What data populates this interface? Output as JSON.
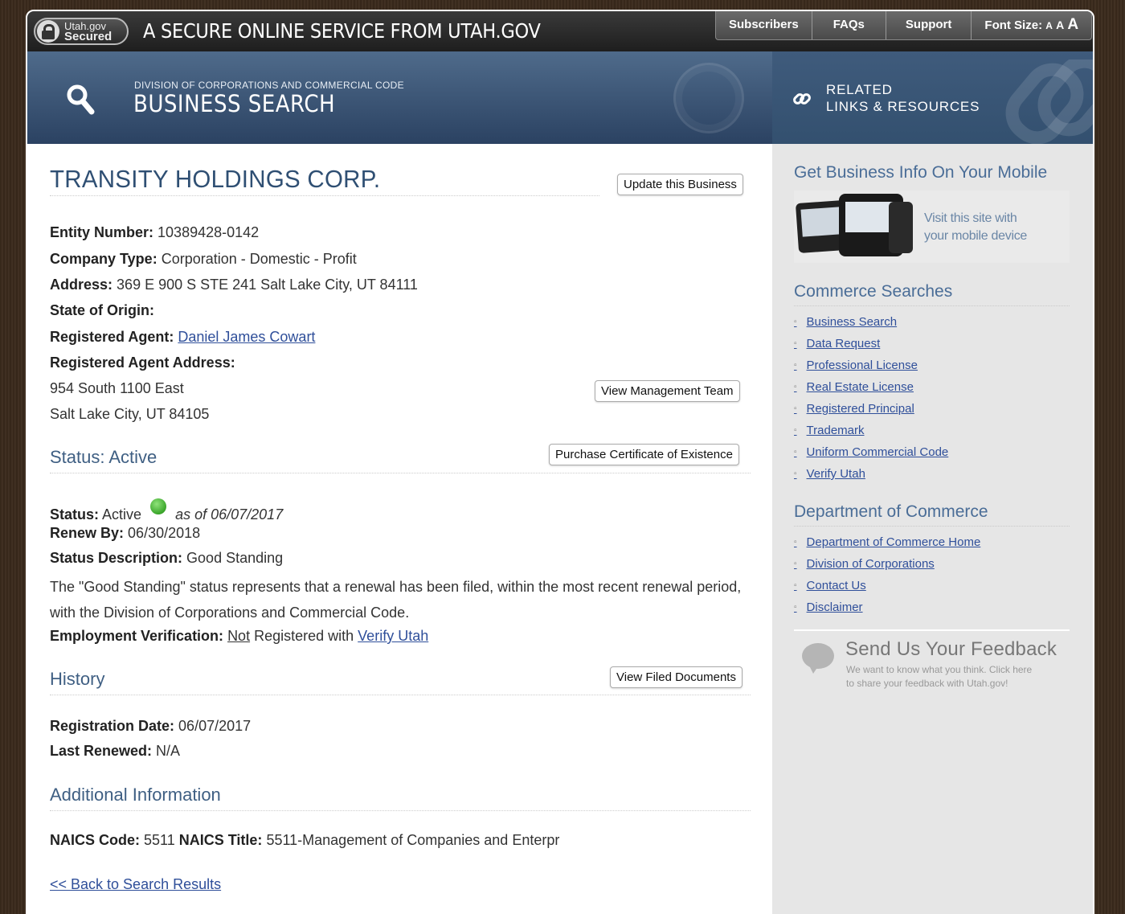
{
  "topbar": {
    "secured_line1": "Utah.gov",
    "secured_line2": "Secured",
    "tagline": "A SECURE ONLINE SERVICE FROM UTAH.GOV",
    "nav": [
      "Subscribers",
      "FAQs",
      "Support"
    ],
    "font_size_label": "Font Size:",
    "font_size_options": [
      "A",
      "A",
      "A"
    ]
  },
  "banner": {
    "subtitle": "DIVISION OF CORPORATIONS AND COMMERCIAL CODE",
    "title": "BUSINESS SEARCH",
    "related_line1": "RELATED",
    "related_line2": "LINKS & RESOURCES"
  },
  "business": {
    "name": "TRANSITY HOLDINGS CORP.",
    "update_button": "Update this Business",
    "entity_number_label": "Entity Number:",
    "entity_number": "10389428-0142",
    "company_type_label": "Company Type:",
    "company_type": "Corporation - Domestic - Profit",
    "address_label": "Address:",
    "address": "369 E 900 S STE 241 Salt Lake City, UT 84111",
    "state_origin_label": "State of Origin:",
    "state_origin": "",
    "agent_label": "Registered Agent:",
    "agent": "Daniel James Cowart",
    "agent_address_label": "Registered Agent Address:",
    "agent_address_line1": "954 South 1100 East",
    "agent_address_line2": "Salt Lake City, UT 84105",
    "management_button": "View Management Team"
  },
  "status": {
    "heading": "Status: Active",
    "certificate_button": "Purchase Certificate of Existence",
    "status_label": "Status:",
    "status_value": "Active",
    "as_of": "as of 06/07/2017",
    "renew_label": "Renew By:",
    "renew_value": "06/30/2018",
    "description_label": "Status Description:",
    "description_value": "Good Standing",
    "description_text": "The \"Good Standing\" status represents that a renewal has been filed, within the most recent renewal period, with the Division of Corporations and Commercial Code.",
    "employment_label": "Employment Verification:",
    "employment_not": "Not",
    "employment_mid": "Registered with",
    "employment_link": "Verify Utah"
  },
  "history": {
    "heading": "History",
    "filed_button": "View Filed Documents",
    "registration_label": "Registration Date:",
    "registration_value": "06/07/2017",
    "renewed_label": "Last Renewed:",
    "renewed_value": "N/A"
  },
  "additional": {
    "heading": "Additional Information",
    "naics_code_label": "NAICS Code:",
    "naics_code": "5511",
    "naics_title_label": "NAICS Title:",
    "naics_title": "5511-Management of Companies and Enterpr"
  },
  "back_link": "<< Back to Search Results",
  "sidebar": {
    "mobile_heading": "Get Business Info On Your Mobile",
    "mobile_text1": "Visit this site with",
    "mobile_text2": "your mobile device",
    "commerce_heading": "Commerce Searches",
    "commerce_links": [
      "Business Search",
      "Data Request",
      "Professional License",
      "Real Estate License",
      "Registered Principal",
      "Trademark",
      "Uniform Commercial Code",
      "Verify Utah"
    ],
    "department_heading": "Department of Commerce",
    "department_links": [
      "Department of Commerce Home",
      "Division of Corporations",
      "Contact Us",
      "Disclaimer"
    ],
    "feedback_title": "Send Us Your Feedback",
    "feedback_line1": "We want to know what you think. Click here",
    "feedback_line2": "to share your feedback with Utah.gov!"
  },
  "colors": {
    "accent": "#2f4f73",
    "link": "#2f4f9a",
    "status_active": "#3aa52a"
  }
}
